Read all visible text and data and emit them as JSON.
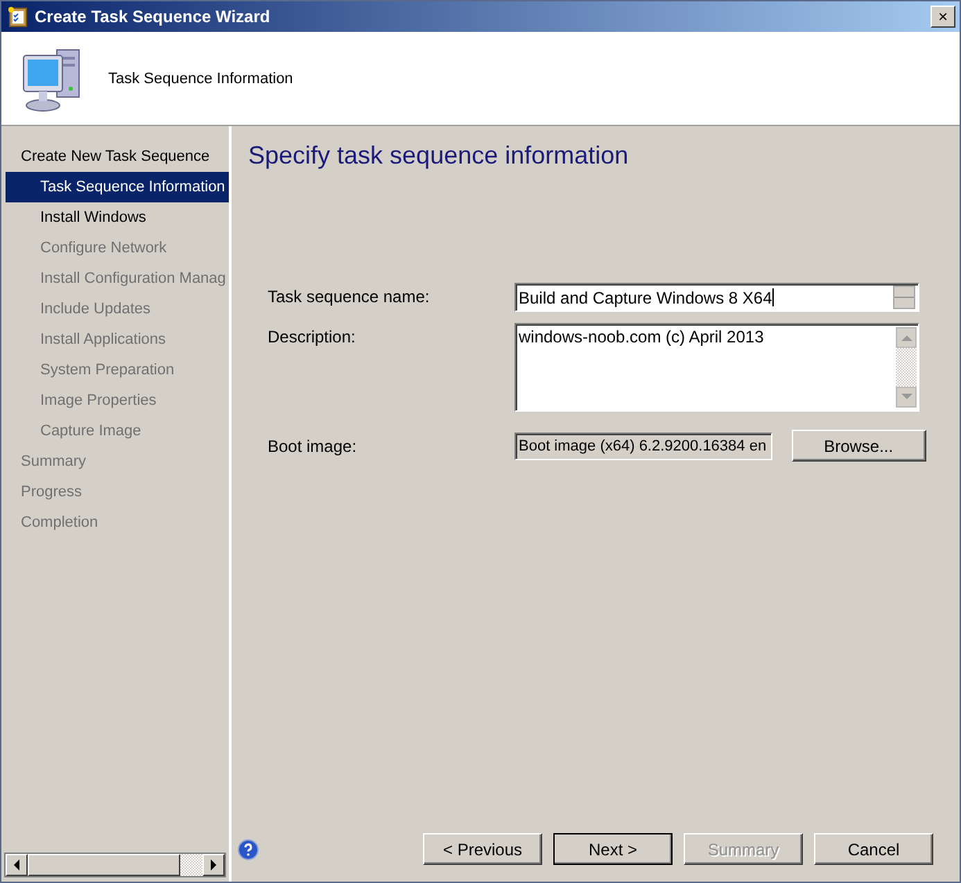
{
  "window": {
    "title": "Create Task Sequence Wizard",
    "close": "×"
  },
  "header": {
    "title": "Task Sequence Information"
  },
  "sidebar": {
    "items": [
      {
        "label": "Create New Task Sequence",
        "selected": false,
        "disabled": false,
        "children": [
          {
            "label": "Task Sequence Information",
            "selected": true,
            "disabled": false
          },
          {
            "label": "Install Windows",
            "selected": false,
            "disabled": false
          },
          {
            "label": "Configure Network",
            "selected": false,
            "disabled": true
          },
          {
            "label": "Install Configuration Manag",
            "selected": false,
            "disabled": true
          },
          {
            "label": "Include Updates",
            "selected": false,
            "disabled": true
          },
          {
            "label": "Install Applications",
            "selected": false,
            "disabled": true
          },
          {
            "label": "System Preparation",
            "selected": false,
            "disabled": true
          },
          {
            "label": "Image Properties",
            "selected": false,
            "disabled": true
          },
          {
            "label": "Capture Image",
            "selected": false,
            "disabled": true
          }
        ]
      },
      {
        "label": "Summary",
        "selected": false,
        "disabled": true
      },
      {
        "label": "Progress",
        "selected": false,
        "disabled": true
      },
      {
        "label": "Completion",
        "selected": false,
        "disabled": true
      }
    ]
  },
  "page": {
    "heading": "Specify task sequence information",
    "fields": [
      {
        "kind": "text",
        "label": "Task sequence name:",
        "value": "Build and Capture Windows 8 X64"
      },
      {
        "kind": "multiline",
        "label": "Description:",
        "value": "windows-noob.com (c) April 2013"
      },
      {
        "kind": "readonly",
        "label": "Boot image:",
        "value": "Boot image (x64) 6.2.9200.16384 en",
        "button": "Browse..."
      }
    ]
  },
  "buttons": [
    {
      "label": "< Previous",
      "default": false,
      "disabled": false
    },
    {
      "label": "Next >",
      "default": true,
      "disabled": false
    },
    {
      "label": "Summary",
      "default": false,
      "disabled": true
    },
    {
      "label": "Cancel",
      "default": false,
      "disabled": false
    }
  ]
}
